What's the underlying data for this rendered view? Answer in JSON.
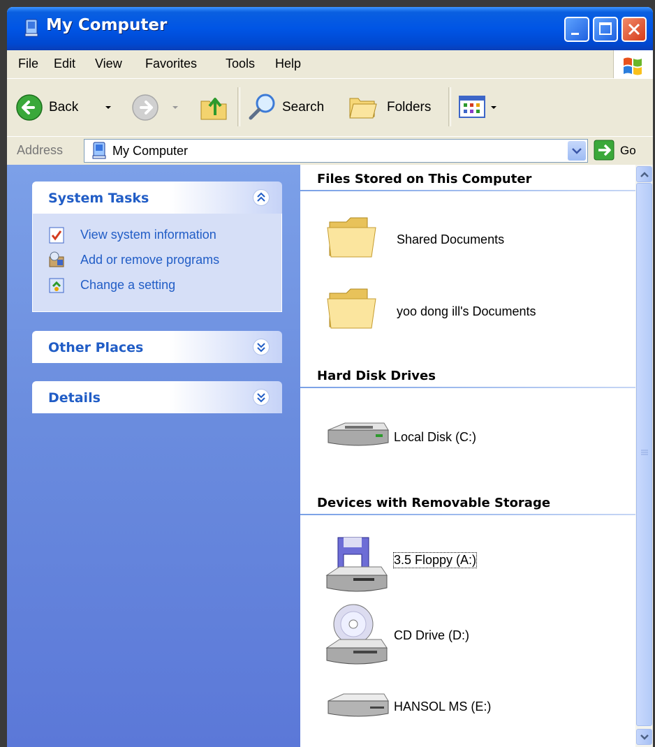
{
  "window": {
    "title": "My Computer"
  },
  "menu": [
    "File",
    "Edit",
    "View",
    "Favorites",
    "Tools",
    "Help"
  ],
  "toolbar": {
    "back_label": "Back",
    "search_label": "Search",
    "folders_label": "Folders"
  },
  "address": {
    "label": "Address",
    "value": "My Computer",
    "go_label": "Go"
  },
  "left_pane": {
    "system_tasks": {
      "title": "System Tasks",
      "items": [
        "View system information",
        "Add or remove programs",
        "Change a setting"
      ]
    },
    "other_places": {
      "title": "Other Places"
    },
    "details": {
      "title": "Details"
    }
  },
  "sections": {
    "files": {
      "title": "Files Stored on This Computer",
      "items": [
        "Shared Documents",
        "yoo dong ill's Documents"
      ]
    },
    "hard_disks": {
      "title": "Hard Disk Drives",
      "items": [
        "Local Disk (C:)"
      ]
    },
    "removable": {
      "title": "Devices with Removable Storage",
      "items": [
        "3.5 Floppy (A:)",
        "CD Drive (D:)",
        "HANSOL MS (E:)"
      ]
    }
  },
  "colors": {
    "title_bar": "#0055E5",
    "task_pane": "#6A8CDE",
    "link": "#215DC6"
  }
}
